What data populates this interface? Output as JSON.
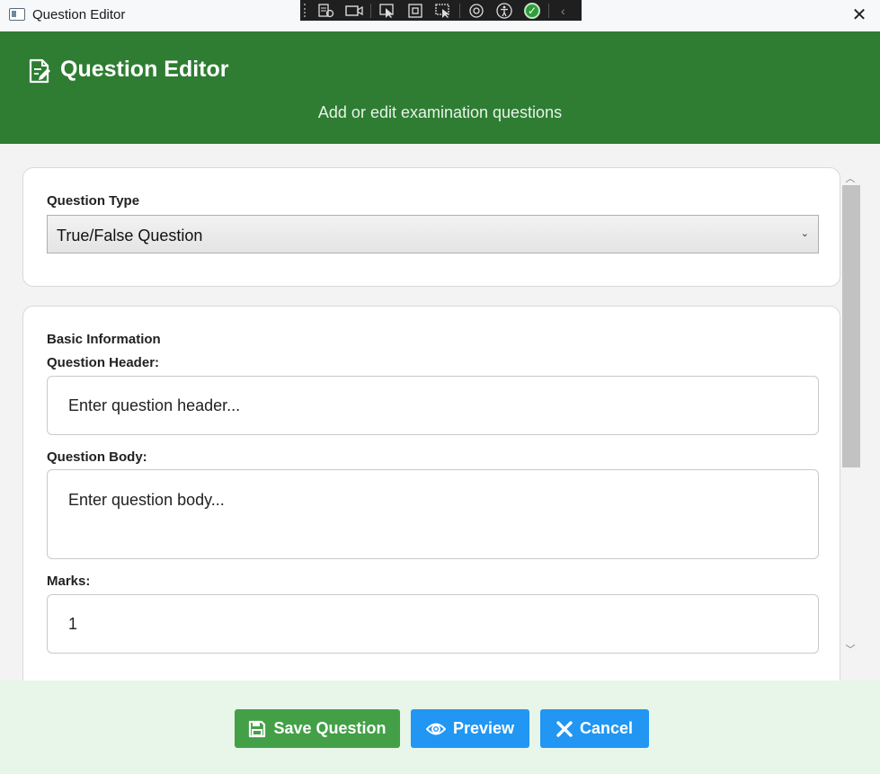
{
  "window": {
    "title": "Question Editor",
    "close_glyph": "✕"
  },
  "devtools": {
    "items": [
      "select-element-icon",
      "record-icon",
      "pointer-icon",
      "frame-icon",
      "screen-pointer-icon",
      "layout-icon",
      "accessibility-icon",
      "check-icon",
      "collapse-icon"
    ]
  },
  "header": {
    "title": "Question Editor",
    "subtitle": "Add or edit examination questions",
    "icon": "edit-document-icon",
    "background": "#2e7d32"
  },
  "question_type": {
    "label": "Question Type",
    "selected": "True/False Question"
  },
  "basic_info": {
    "section_title": "Basic Information",
    "header_label": "Question Header:",
    "header_placeholder": "Enter question header...",
    "body_label": "Question Body:",
    "body_placeholder": "Enter question body...",
    "marks_label": "Marks:",
    "marks_value": "1"
  },
  "footer": {
    "save_label": "Save Question",
    "preview_label": "Preview",
    "cancel_label": "Cancel",
    "save_color": "#43a047",
    "primary_color": "#2196f3",
    "background": "#e8f5e9"
  }
}
